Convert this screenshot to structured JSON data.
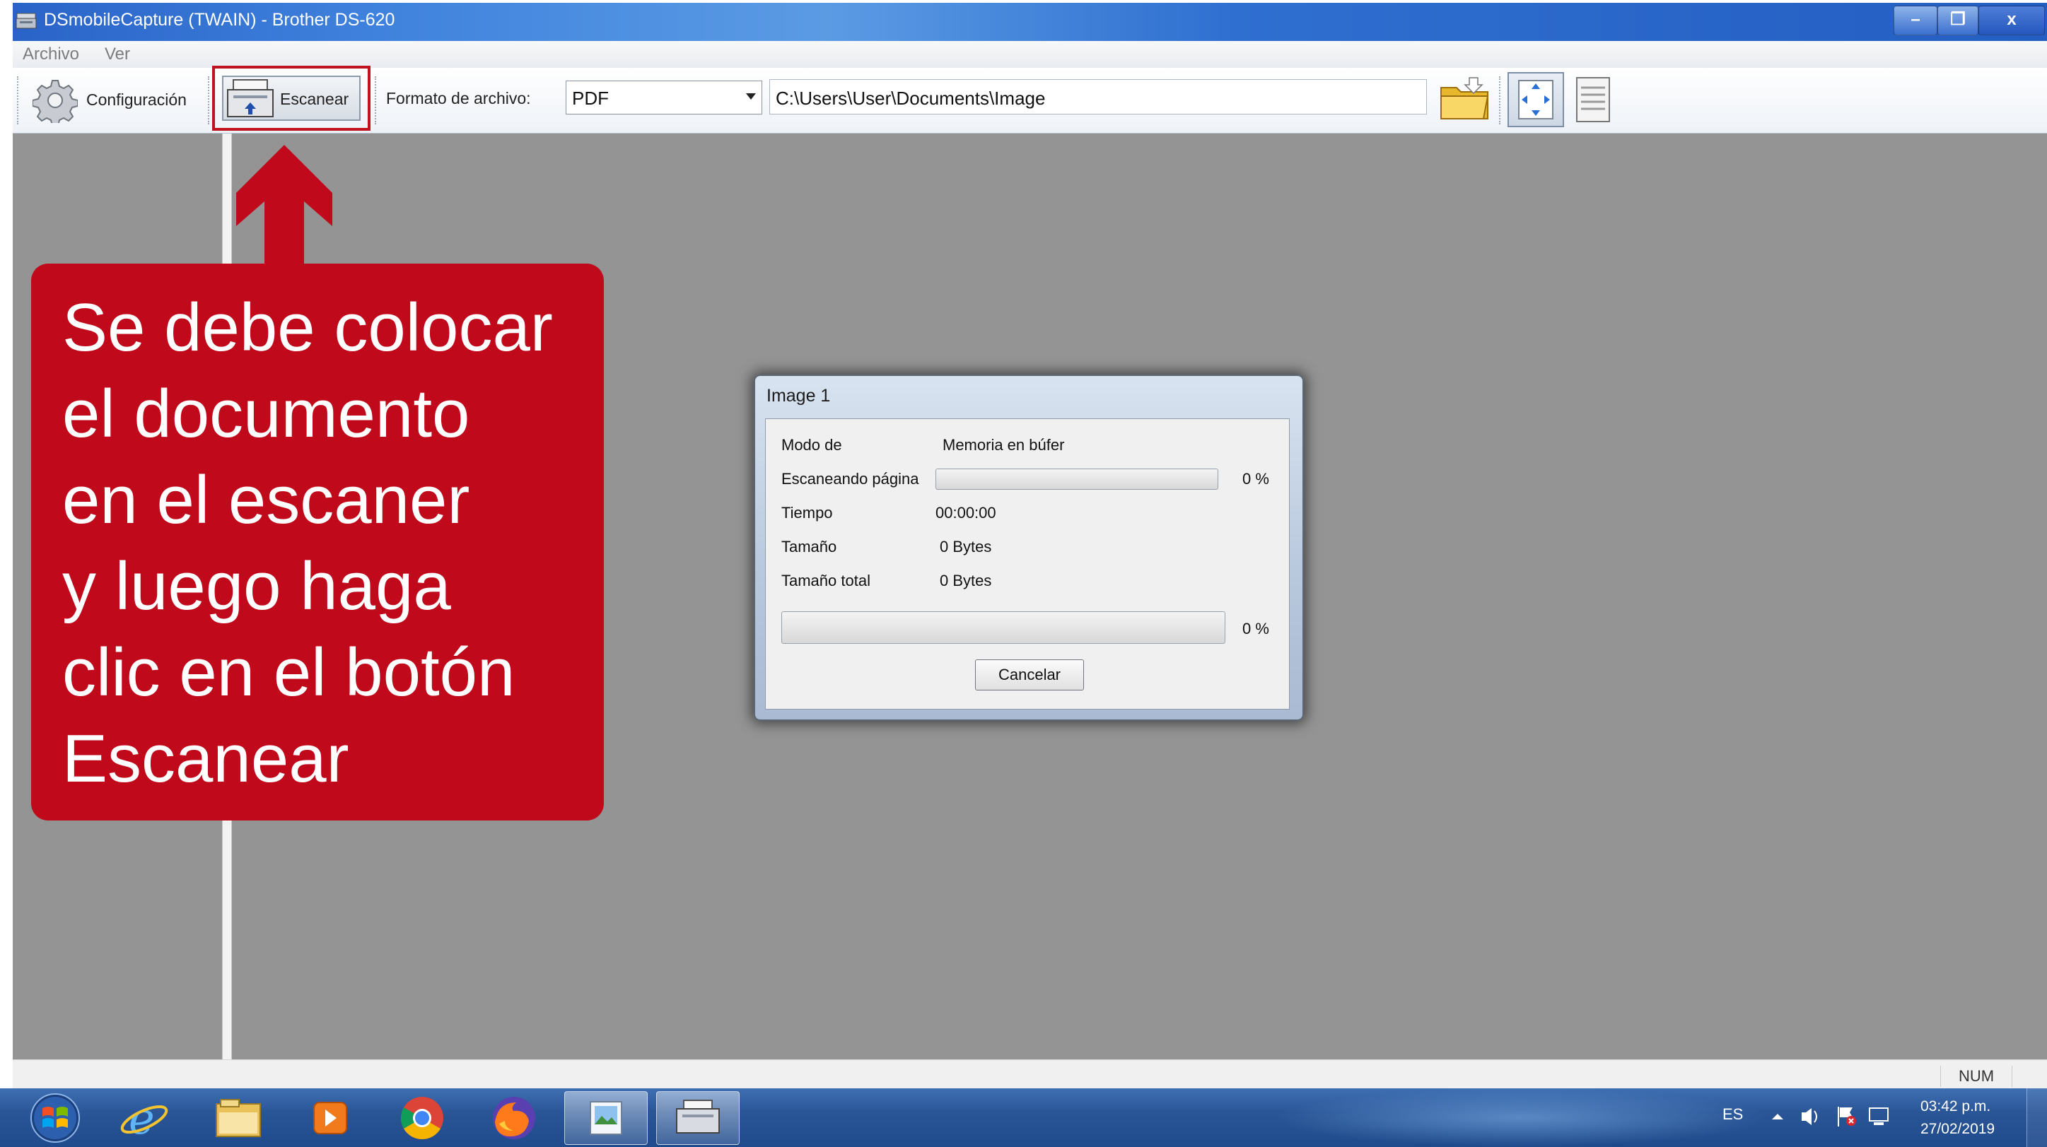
{
  "window": {
    "title": "DSmobileCapture (TWAIN) - Brother DS-620",
    "min_glyph": "–",
    "max_glyph": "❐",
    "close_glyph": "x"
  },
  "menu": {
    "items": [
      "Archivo",
      "Ver"
    ]
  },
  "toolbar": {
    "config_label": "Configuración",
    "scan_label": "Escanear",
    "format_label": "Formato de archivo:",
    "format_value": "PDF",
    "path_value": "C:\\Users\\User\\Documents\\Image"
  },
  "dialog": {
    "title": "Image 1",
    "rows": [
      {
        "label": "Modo de",
        "value": "Memoria en búfer"
      },
      {
        "label": "Escaneando página",
        "value": "0 %"
      },
      {
        "label": "Tiempo",
        "value": "00:00:00"
      },
      {
        "label": "Tamaño",
        "value": "0 Bytes"
      },
      {
        "label": "Tamaño total",
        "value": "0 Bytes"
      }
    ],
    "page_progress": 0,
    "total_progress": 0,
    "total_pct": "0 %",
    "cancel_label": "Cancelar"
  },
  "callout": {
    "lines": [
      "Se debe colocar",
      "el documento",
      "en el escaner",
      "y luego haga",
      "clic en el botón",
      "Escanear"
    ],
    "color": "#c0091a"
  },
  "statusbar": {
    "num": "NUM"
  },
  "taskbar": {
    "lang": "ES",
    "time": "03:42 p.m.",
    "date": "27/02/2019",
    "icons": [
      "start-orb",
      "internet-explorer-icon",
      "file-explorer-icon",
      "media-player-icon",
      "chrome-icon",
      "firefox-icon",
      "photo-viewer-icon",
      "scanner-app-icon"
    ]
  }
}
